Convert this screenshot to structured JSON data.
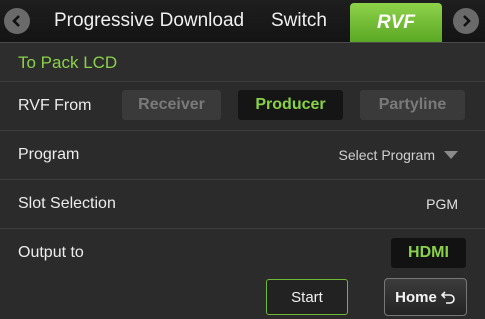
{
  "tabs": {
    "prev_icon": "chevron-left-icon",
    "next_icon": "chevron-right-icon",
    "items": [
      "Progressive Download",
      "Switch"
    ],
    "active": "RVF"
  },
  "section": {
    "title": "To Pack LCD"
  },
  "rvf_from": {
    "label": "RVF From",
    "options": [
      "Receiver",
      "Producer",
      "Partyline"
    ],
    "selected": "Producer"
  },
  "program": {
    "label": "Program",
    "value": "Select Program"
  },
  "slot": {
    "label": "Slot Selection",
    "value": "PGM"
  },
  "output": {
    "label": "Output to",
    "value": "HDMI"
  },
  "footer": {
    "start_label": "Start",
    "home_label": "Home",
    "home_icon": "return-arrow-icon"
  },
  "colors": {
    "accent": "#8ad14a",
    "tab_active": "#6cbf2e",
    "background": "#2a2a2a"
  }
}
